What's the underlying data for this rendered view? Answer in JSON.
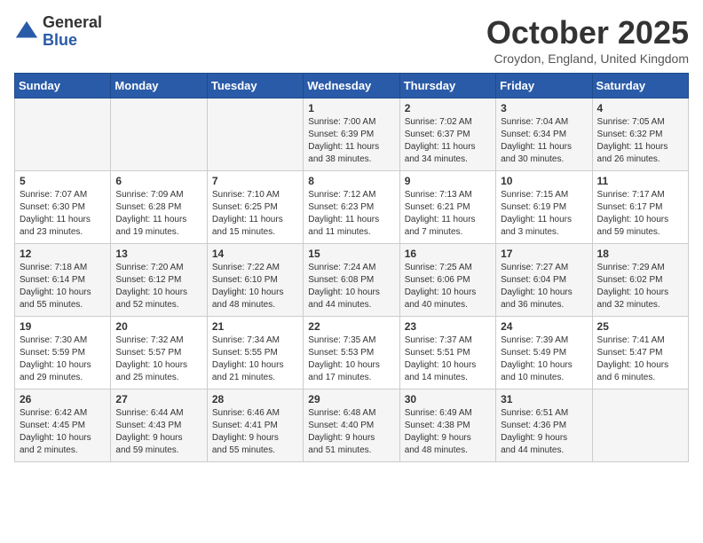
{
  "logo": {
    "general": "General",
    "blue": "Blue"
  },
  "title": "October 2025",
  "subtitle": "Croydon, England, United Kingdom",
  "days_of_week": [
    "Sunday",
    "Monday",
    "Tuesday",
    "Wednesday",
    "Thursday",
    "Friday",
    "Saturday"
  ],
  "weeks": [
    [
      {
        "day": "",
        "info": ""
      },
      {
        "day": "",
        "info": ""
      },
      {
        "day": "",
        "info": ""
      },
      {
        "day": "1",
        "info": "Sunrise: 7:00 AM\nSunset: 6:39 PM\nDaylight: 11 hours\nand 38 minutes."
      },
      {
        "day": "2",
        "info": "Sunrise: 7:02 AM\nSunset: 6:37 PM\nDaylight: 11 hours\nand 34 minutes."
      },
      {
        "day": "3",
        "info": "Sunrise: 7:04 AM\nSunset: 6:34 PM\nDaylight: 11 hours\nand 30 minutes."
      },
      {
        "day": "4",
        "info": "Sunrise: 7:05 AM\nSunset: 6:32 PM\nDaylight: 11 hours\nand 26 minutes."
      }
    ],
    [
      {
        "day": "5",
        "info": "Sunrise: 7:07 AM\nSunset: 6:30 PM\nDaylight: 11 hours\nand 23 minutes."
      },
      {
        "day": "6",
        "info": "Sunrise: 7:09 AM\nSunset: 6:28 PM\nDaylight: 11 hours\nand 19 minutes."
      },
      {
        "day": "7",
        "info": "Sunrise: 7:10 AM\nSunset: 6:25 PM\nDaylight: 11 hours\nand 15 minutes."
      },
      {
        "day": "8",
        "info": "Sunrise: 7:12 AM\nSunset: 6:23 PM\nDaylight: 11 hours\nand 11 minutes."
      },
      {
        "day": "9",
        "info": "Sunrise: 7:13 AM\nSunset: 6:21 PM\nDaylight: 11 hours\nand 7 minutes."
      },
      {
        "day": "10",
        "info": "Sunrise: 7:15 AM\nSunset: 6:19 PM\nDaylight: 11 hours\nand 3 minutes."
      },
      {
        "day": "11",
        "info": "Sunrise: 7:17 AM\nSunset: 6:17 PM\nDaylight: 10 hours\nand 59 minutes."
      }
    ],
    [
      {
        "day": "12",
        "info": "Sunrise: 7:18 AM\nSunset: 6:14 PM\nDaylight: 10 hours\nand 55 minutes."
      },
      {
        "day": "13",
        "info": "Sunrise: 7:20 AM\nSunset: 6:12 PM\nDaylight: 10 hours\nand 52 minutes."
      },
      {
        "day": "14",
        "info": "Sunrise: 7:22 AM\nSunset: 6:10 PM\nDaylight: 10 hours\nand 48 minutes."
      },
      {
        "day": "15",
        "info": "Sunrise: 7:24 AM\nSunset: 6:08 PM\nDaylight: 10 hours\nand 44 minutes."
      },
      {
        "day": "16",
        "info": "Sunrise: 7:25 AM\nSunset: 6:06 PM\nDaylight: 10 hours\nand 40 minutes."
      },
      {
        "day": "17",
        "info": "Sunrise: 7:27 AM\nSunset: 6:04 PM\nDaylight: 10 hours\nand 36 minutes."
      },
      {
        "day": "18",
        "info": "Sunrise: 7:29 AM\nSunset: 6:02 PM\nDaylight: 10 hours\nand 32 minutes."
      }
    ],
    [
      {
        "day": "19",
        "info": "Sunrise: 7:30 AM\nSunset: 5:59 PM\nDaylight: 10 hours\nand 29 minutes."
      },
      {
        "day": "20",
        "info": "Sunrise: 7:32 AM\nSunset: 5:57 PM\nDaylight: 10 hours\nand 25 minutes."
      },
      {
        "day": "21",
        "info": "Sunrise: 7:34 AM\nSunset: 5:55 PM\nDaylight: 10 hours\nand 21 minutes."
      },
      {
        "day": "22",
        "info": "Sunrise: 7:35 AM\nSunset: 5:53 PM\nDaylight: 10 hours\nand 17 minutes."
      },
      {
        "day": "23",
        "info": "Sunrise: 7:37 AM\nSunset: 5:51 PM\nDaylight: 10 hours\nand 14 minutes."
      },
      {
        "day": "24",
        "info": "Sunrise: 7:39 AM\nSunset: 5:49 PM\nDaylight: 10 hours\nand 10 minutes."
      },
      {
        "day": "25",
        "info": "Sunrise: 7:41 AM\nSunset: 5:47 PM\nDaylight: 10 hours\nand 6 minutes."
      }
    ],
    [
      {
        "day": "26",
        "info": "Sunrise: 6:42 AM\nSunset: 4:45 PM\nDaylight: 10 hours\nand 2 minutes."
      },
      {
        "day": "27",
        "info": "Sunrise: 6:44 AM\nSunset: 4:43 PM\nDaylight: 9 hours\nand 59 minutes."
      },
      {
        "day": "28",
        "info": "Sunrise: 6:46 AM\nSunset: 4:41 PM\nDaylight: 9 hours\nand 55 minutes."
      },
      {
        "day": "29",
        "info": "Sunrise: 6:48 AM\nSunset: 4:40 PM\nDaylight: 9 hours\nand 51 minutes."
      },
      {
        "day": "30",
        "info": "Sunrise: 6:49 AM\nSunset: 4:38 PM\nDaylight: 9 hours\nand 48 minutes."
      },
      {
        "day": "31",
        "info": "Sunrise: 6:51 AM\nSunset: 4:36 PM\nDaylight: 9 hours\nand 44 minutes."
      },
      {
        "day": "",
        "info": ""
      }
    ]
  ]
}
